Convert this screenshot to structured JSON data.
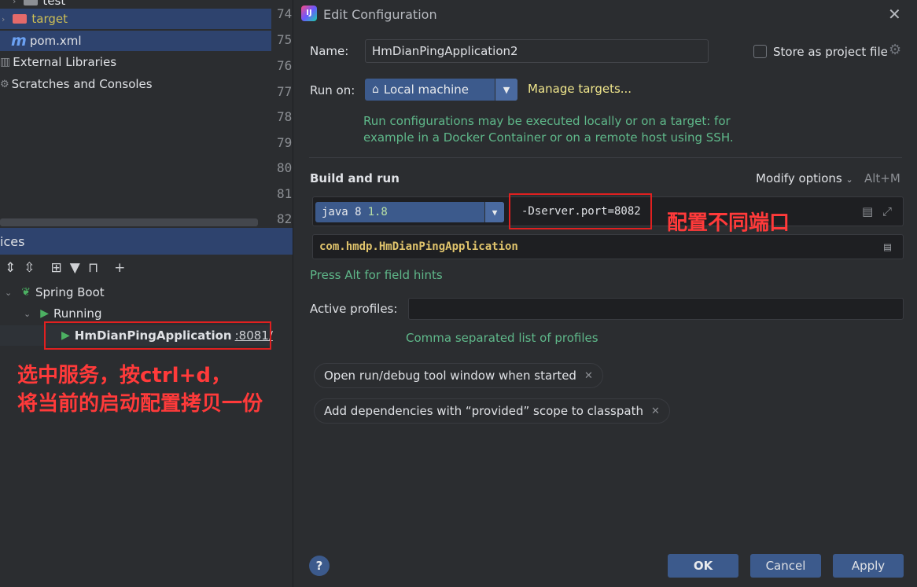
{
  "project_tree": {
    "items": [
      {
        "label": "test"
      },
      {
        "label": "target"
      },
      {
        "label": "pom.xml"
      },
      {
        "label": "External Libraries"
      },
      {
        "label": "Scratches and Consoles"
      }
    ]
  },
  "line_numbers": [
    "74",
    "75",
    "76",
    "77",
    "78",
    "79",
    "80",
    "81",
    "82"
  ],
  "services": {
    "header": "ices",
    "tree": {
      "spring_boot": "Spring Boot",
      "running": "Running",
      "app_name": "HmDianPingApplication",
      "app_port": ":8081/"
    },
    "annotation_line1": "选中服务，按ctrl+d，",
    "annotation_line2": "将当前的启动配置拷贝一份"
  },
  "dialog": {
    "title": "Edit Configuration",
    "name_label": "Name:",
    "name_value": "HmDianPingApplication2",
    "store_label": "Store as project file",
    "run_on_label": "Run on:",
    "run_on_value": "Local machine",
    "manage_targets": "Manage targets...",
    "run_hint_line1": "Run configurations may be executed locally or on a target: for",
    "run_hint_line2": "example in a Docker Container or on a remote host using SSH.",
    "build_run_title": "Build and run",
    "modify_options": "Modify options",
    "modify_shortcut": "Alt+M",
    "jdk_name": "java 8",
    "jdk_version": "1.8",
    "vm_options": "-Dserver.port=8082",
    "vm_annotation": "配置不同端口",
    "main_class": "com.hmdp.HmDianPingApplication",
    "field_hint": "Press Alt for field hints",
    "active_profiles_label": "Active profiles:",
    "active_profiles_value": "",
    "profiles_hint": "Comma separated list of profiles",
    "chips": [
      {
        "label": "Open run/debug tool window when started"
      },
      {
        "label": "Add dependencies with “provided” scope to classpath"
      }
    ],
    "ok": "OK",
    "cancel": "Cancel",
    "apply": "Apply"
  },
  "colors": {
    "accent_blue": "#3c5a8c",
    "annotation_red": "#ff3a3a",
    "hint_green": "#5fb88a",
    "link_yellow": "#f0e68c"
  }
}
